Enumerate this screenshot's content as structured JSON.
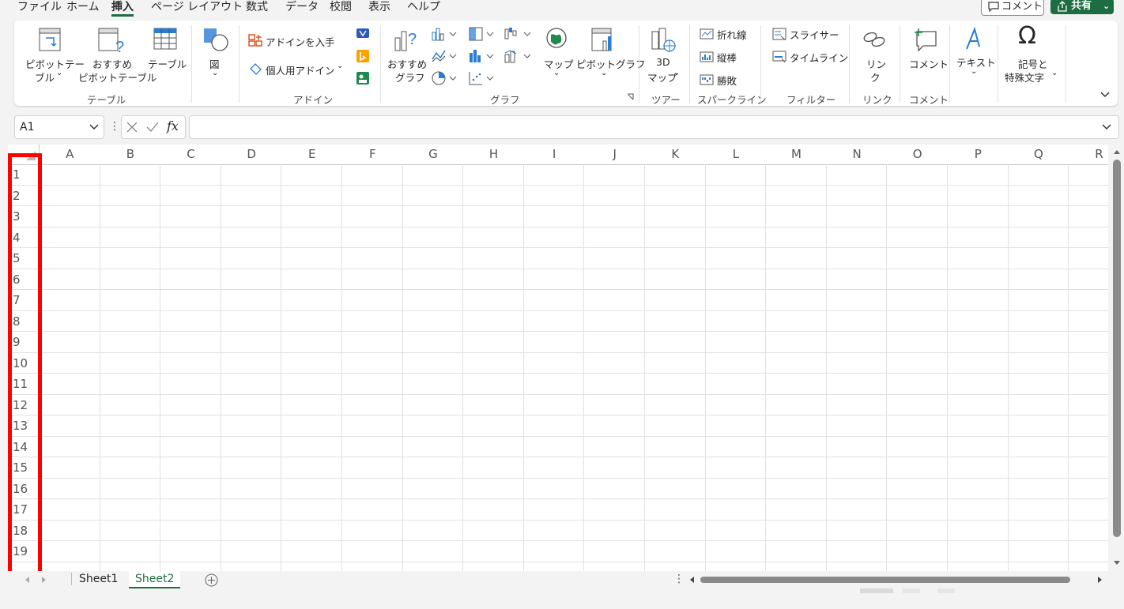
{
  "menu": {
    "tabs": [
      "ファイル",
      "ホーム",
      "挿入",
      "ページ レイアウト",
      "数式",
      "データ",
      "校閲",
      "表示",
      "ヘルプ"
    ],
    "active": "挿入",
    "comment_label": "コメント",
    "share_label": "共有"
  },
  "ribbon": {
    "pivot_table_line1": "ピボットテー",
    "pivot_table_line2": "ブル",
    "recommended_pivot_line1": "おすすめ",
    "recommended_pivot_line2": "ピボットテーブル",
    "table": "テーブル",
    "illustrations": "図",
    "get_addins": "アドインを入手",
    "my_addins": "個人用アドイン",
    "recommended_charts_line1": "おすすめ",
    "recommended_charts_line2": "グラフ",
    "maps": "マップ",
    "pivot_chart": "ピボットグラフ",
    "map3d_line1": "3D",
    "map3d_line2": "マップ",
    "spark_line": "折れ線",
    "spark_column": "縦棒",
    "spark_winloss": "勝敗",
    "slicer": "スライサー",
    "timeline": "タイムライン",
    "link_line1": "リン",
    "link_line2": "ク",
    "comment": "コメント",
    "text": "テキスト",
    "symbols_line1": "記号と",
    "symbols_line2": "特殊文字",
    "groups": {
      "tables": "テーブル",
      "addins": "アドイン",
      "charts": "グラフ",
      "tours": "ツアー",
      "sparklines": "スパークライン",
      "filters": "フィルター",
      "links": "リンク",
      "comments": "コメント"
    }
  },
  "formula": {
    "name_box": "A1",
    "fx_label": "fx",
    "value": ""
  },
  "grid": {
    "columns": [
      "A",
      "B",
      "C",
      "D",
      "E",
      "F",
      "G",
      "H",
      "I",
      "J",
      "K",
      "L",
      "M",
      "N",
      "O",
      "P",
      "Q",
      "R"
    ],
    "rows": [
      "1",
      "2",
      "3",
      "4",
      "5",
      "6",
      "7",
      "8",
      "9",
      "10",
      "11",
      "12",
      "13",
      "14",
      "15",
      "16",
      "17",
      "18",
      "19"
    ]
  },
  "sheets": [
    "Sheet1",
    "Sheet2"
  ],
  "active_sheet": "Sheet2",
  "colors": {
    "accent": "#1e6c41",
    "highlight": "#ff0000"
  }
}
